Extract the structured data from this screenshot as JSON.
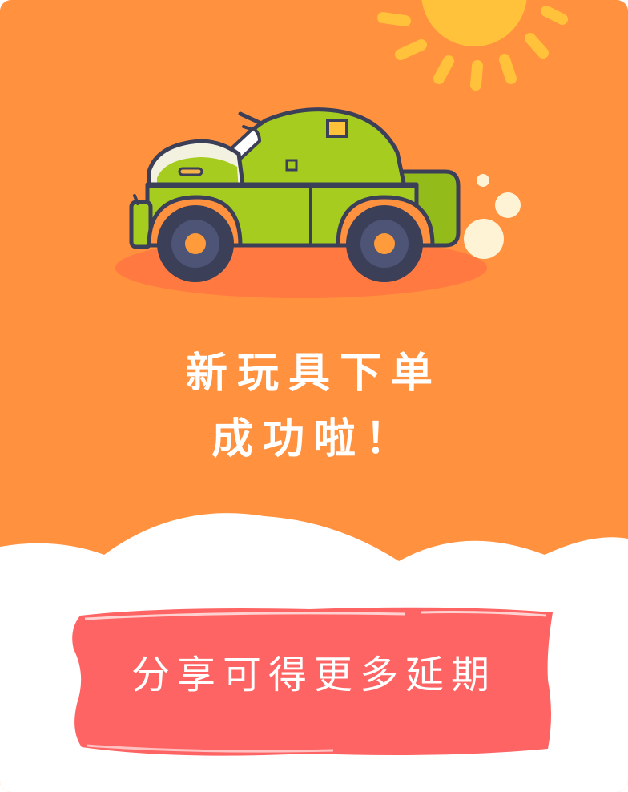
{
  "headline": {
    "line1": "新玩具下单",
    "line2": "成功啦！"
  },
  "share_button": {
    "label": "分享可得更多延期"
  },
  "colors": {
    "background_orange": "#ff913f",
    "button_red": "#ff6464",
    "car_green": "#a5cc1f",
    "sun_yellow": "#ffc23a",
    "outline": "#3b3f58",
    "text": "#ffffff"
  },
  "icons": {
    "illustration": "car-illustration",
    "sun": "sun-icon"
  }
}
